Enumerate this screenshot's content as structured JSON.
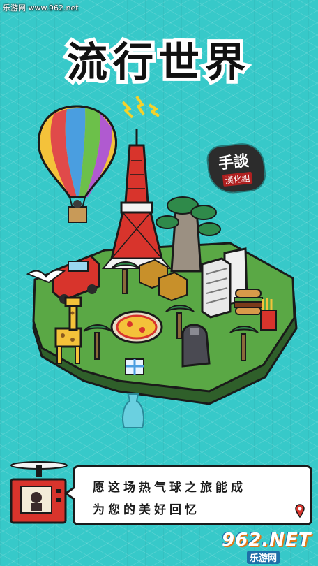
{
  "watermark_top": "乐游网 www.962.net",
  "title": "流行世界",
  "seal": {
    "top": "手談",
    "bottom": "漢化組"
  },
  "dialog": {
    "line1": "愿这场热气球之旅能成",
    "line2": "为您的美好回忆"
  },
  "watermark_bottom": {
    "main": "962.NET",
    "sub": "乐游网"
  },
  "colors": {
    "background": "#37c9c9",
    "grass": "#5aa845",
    "island_edge": "#2a2a2a",
    "tower_red": "#d8342c",
    "dialog_border": "#1a1a1a"
  },
  "icons": [
    "lightning-icon",
    "location-pin-icon",
    "gift-icon"
  ]
}
